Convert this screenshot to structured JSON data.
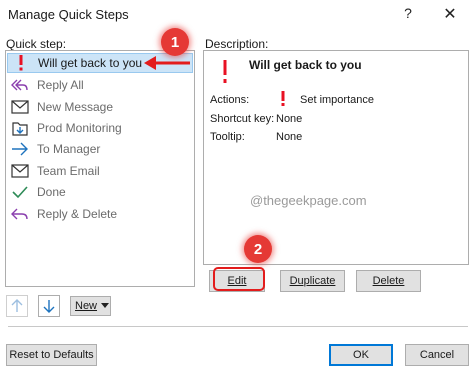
{
  "dialog": {
    "title": "Manage Quick Steps",
    "help_glyph": "?",
    "close_glyph": "✕"
  },
  "left": {
    "label": "Quick step:",
    "items": [
      {
        "label": "Will get back to you",
        "icon": "exclamation-icon",
        "selected": true
      },
      {
        "label": "Reply All",
        "icon": "reply-all-icon"
      },
      {
        "label": "New Message",
        "icon": "envelope-icon"
      },
      {
        "label": "Prod Monitoring",
        "icon": "move-to-folder-icon"
      },
      {
        "label": "To Manager",
        "icon": "arrow-right-icon"
      },
      {
        "label": "Team Email",
        "icon": "envelope-icon"
      },
      {
        "label": "Done",
        "icon": "checkmark-icon"
      },
      {
        "label": "Reply & Delete",
        "icon": "reply-delete-icon"
      }
    ],
    "new_label": "New"
  },
  "right": {
    "label": "Description:",
    "title": "Will get back to you",
    "actions_label": "Actions:",
    "actions_value": "Set importance",
    "shortcut_label": "Shortcut key:",
    "shortcut_value": "None",
    "tooltip_label": "Tooltip:",
    "tooltip_value": "None",
    "watermark": "@thegeekpage.com"
  },
  "buttons": {
    "edit": "Edit",
    "duplicate": "Duplicate",
    "delete": "Delete",
    "reset": "Reset to Defaults",
    "ok": "OK",
    "cancel": "Cancel"
  },
  "annotations": {
    "step1": "1",
    "step2": "2"
  },
  "colors": {
    "selection": "#cce4f7",
    "importance_red": "#e81123",
    "annotation_red": "#e53935",
    "icon_blue": "#1e73be",
    "icon_purple": "#8a3fae",
    "icon_green": "#2e8b57"
  }
}
